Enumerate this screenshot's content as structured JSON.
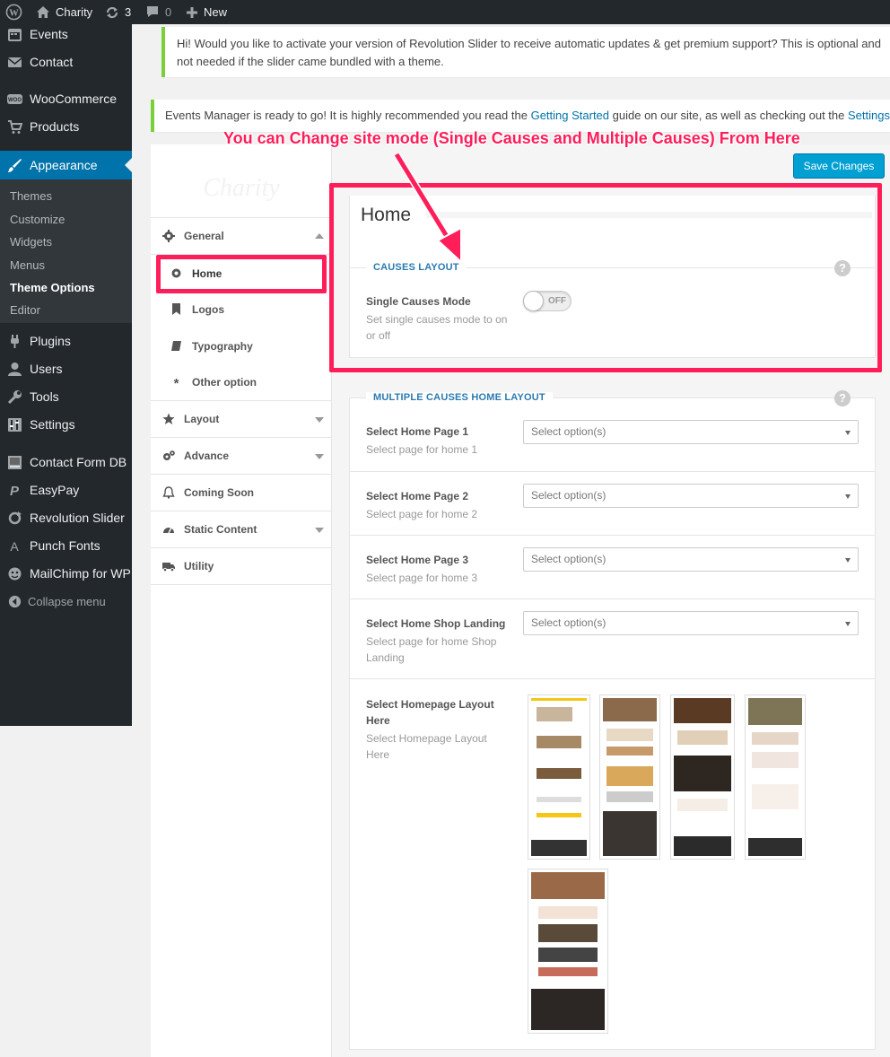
{
  "admin_bar": {
    "site_name": "Charity",
    "updates_count": "3",
    "comments_count": "0",
    "new_label": "New"
  },
  "sidebar": {
    "items": [
      {
        "label": "Events",
        "icon": "calendar-icon"
      },
      {
        "label": "Contact",
        "icon": "mail-icon"
      },
      {
        "label": "WooCommerce",
        "icon": "woo-icon"
      },
      {
        "label": "Products",
        "icon": "cart-icon"
      },
      {
        "label": "Appearance",
        "icon": "brush-icon"
      },
      {
        "label": "Plugins",
        "icon": "plug-icon"
      },
      {
        "label": "Users",
        "icon": "user-icon"
      },
      {
        "label": "Tools",
        "icon": "wrench-icon"
      },
      {
        "label": "Settings",
        "icon": "settings-icon"
      },
      {
        "label": "Contact Form DB",
        "icon": "db-icon"
      },
      {
        "label": "EasyPay",
        "icon": "paypal-icon"
      },
      {
        "label": "Revolution Slider",
        "icon": "refresh-icon"
      },
      {
        "label": "Punch Fonts",
        "icon": "font-icon"
      },
      {
        "label": "MailChimp for WP",
        "icon": "mailchimp-icon"
      },
      {
        "label": "Collapse menu",
        "icon": "collapse-icon"
      }
    ],
    "submenu": [
      "Themes",
      "Customize",
      "Widgets",
      "Menus",
      "Theme Options",
      "Editor"
    ],
    "active_submenu": "Theme Options"
  },
  "notices": {
    "revslider": "Hi! Would you like to activate your version of Revolution Slider to receive automatic updates & get premium support? This is optional and not needed if the slider came bundled with a theme.",
    "events_prefix": "Events Manager is ready to go! It is highly recommended you read the",
    "events_link1": "Getting Started",
    "events_mid": "guide on our site, as well as checking out the",
    "events_link2": "Settings Page",
    "events_suffix": "."
  },
  "annotation": "You can Change site mode (Single Causes and Multiple Causes) From Here",
  "options_panel": {
    "logo_text": "Charity",
    "save_label": "Save Changes",
    "nav": {
      "general": "General",
      "home": "Home",
      "logos": "Logos",
      "typography": "Typography",
      "other": "Other option",
      "layout": "Layout",
      "advance": "Advance",
      "coming_soon": "Coming Soon",
      "static_content": "Static Content",
      "utility": "Utility"
    },
    "page_title": "Home",
    "causes_layout": {
      "title": "CAUSES LAYOUT",
      "field_label": "Single Causes Mode",
      "field_desc": "Set single causes mode to on or off",
      "toggle_state": "OFF"
    },
    "multiple_layout": {
      "title": "MULTIPLE CAUSES HOME LAYOUT",
      "fields": [
        {
          "label": "Select Home Page 1",
          "desc": "Select page for home 1",
          "placeholder": "Select option(s)"
        },
        {
          "label": "Select Home Page 2",
          "desc": "Select page for home 2",
          "placeholder": "Select option(s)"
        },
        {
          "label": "Select Home Page 3",
          "desc": "Select page for home 3",
          "placeholder": "Select option(s)"
        },
        {
          "label": "Select Home Shop Landing",
          "desc": "Select page for home Shop Landing",
          "placeholder": "Select option(s)"
        }
      ],
      "layout_label": "Select Homepage Layout Here",
      "layout_desc": "Select Homepage Layout Here"
    }
  },
  "colors": {
    "accent_blue": "#0073aa",
    "annotation_pink": "#ff1e5a",
    "admin_dark": "#23282d",
    "save_button": "#00a0d2"
  }
}
